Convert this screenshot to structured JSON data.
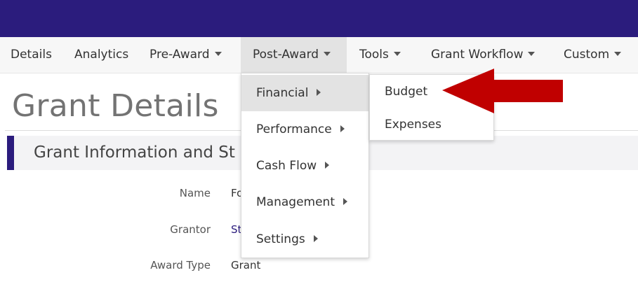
{
  "nav": {
    "items": [
      {
        "label": "Details",
        "has_caret": false
      },
      {
        "label": "Analytics",
        "has_caret": false
      },
      {
        "label": "Pre-Award",
        "has_caret": true
      },
      {
        "label": "Post-Award",
        "has_caret": true,
        "active": true
      },
      {
        "label": "Tools",
        "has_caret": true
      },
      {
        "label": "Grant Workflow",
        "has_caret": true
      },
      {
        "label": "Custom",
        "has_caret": true
      }
    ]
  },
  "page": {
    "title": "Grant Details",
    "section_title": "Grant Information and St"
  },
  "fields": [
    {
      "label": "Name",
      "value": "Fo"
    },
    {
      "label": "Grantor",
      "value": "St"
    },
    {
      "label": "Award Type",
      "value": "Grant"
    }
  ],
  "post_award_menu": {
    "items": [
      "Financial",
      "Performance",
      "Cash Flow",
      "Management",
      "Settings"
    ],
    "hovered_item": "Financial"
  },
  "financial_submenu": {
    "items": [
      "Budget",
      "Expenses"
    ]
  },
  "colors": {
    "brand": "#2b1c7d",
    "annotation_arrow": "#c00000"
  }
}
